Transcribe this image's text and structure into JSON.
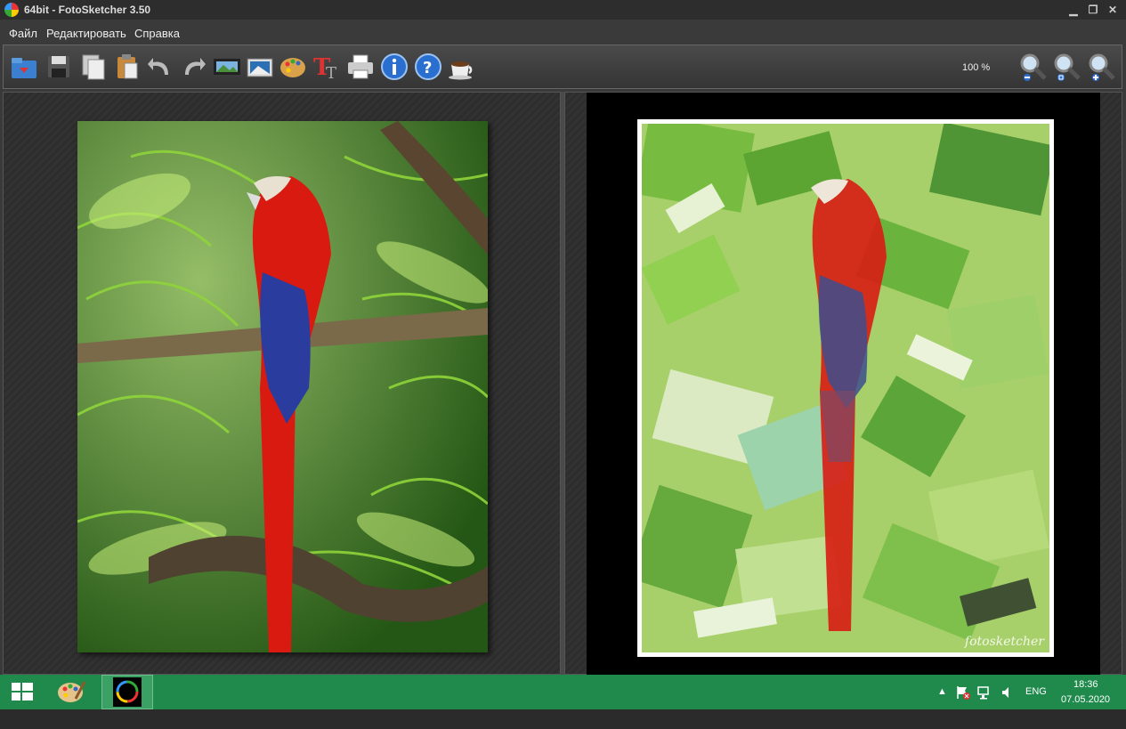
{
  "window": {
    "title": "64bit - FotoSketcher 3.50"
  },
  "menu": {
    "file": "Файл",
    "edit": "Редактировать",
    "help": "Справка"
  },
  "toolbar": {
    "zoom": "100 %"
  },
  "result": {
    "watermark": "fotosketcher"
  },
  "taskbar": {
    "lang": "ENG",
    "time": "18:36",
    "date": "07.05.2020"
  }
}
